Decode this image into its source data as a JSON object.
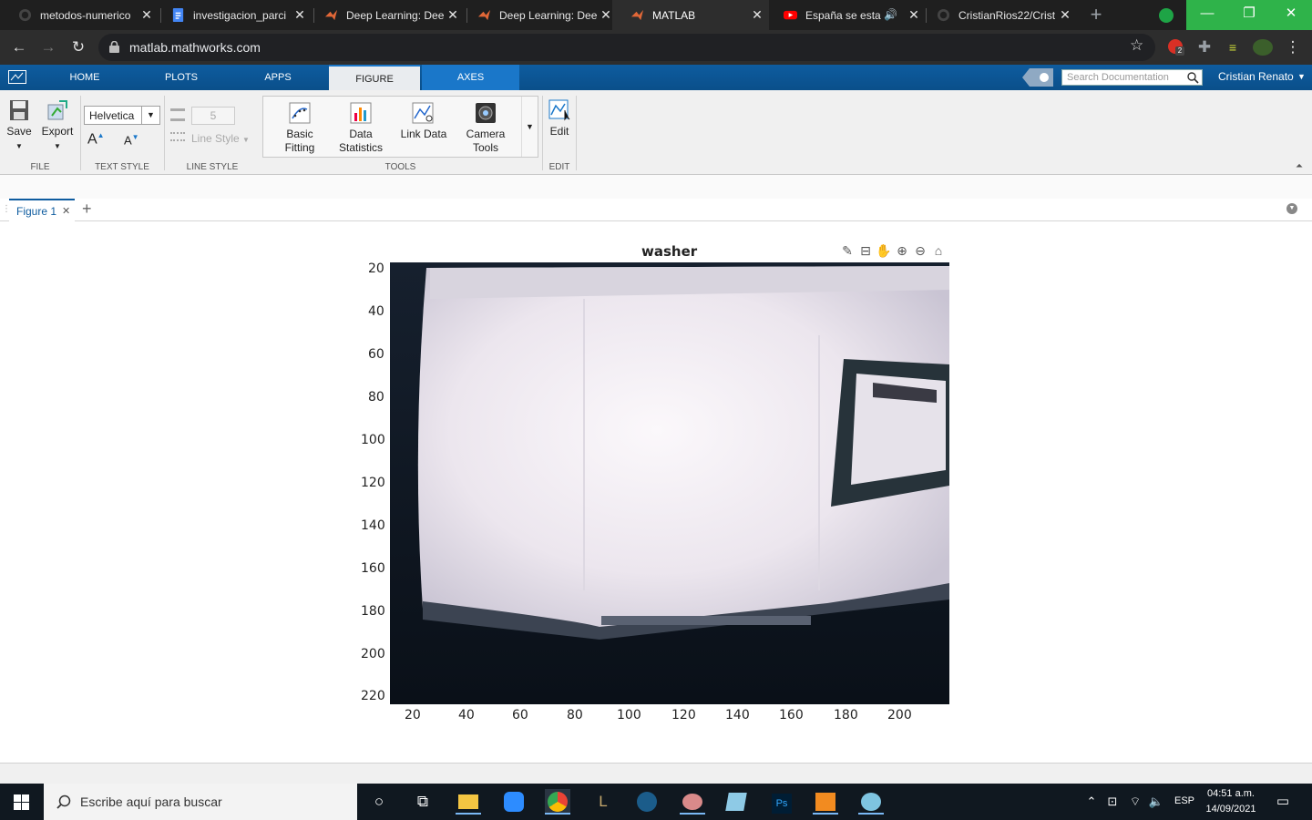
{
  "browser": {
    "tabs": [
      {
        "title": "metodos-numerico",
        "icon": "github-icon"
      },
      {
        "title": "investigacion_parci",
        "icon": "google-docs-icon"
      },
      {
        "title": "Deep Learning: Dee",
        "icon": "matlab-icon"
      },
      {
        "title": "Deep Learning: Dee",
        "icon": "matlab-icon"
      },
      {
        "title": "MATLAB",
        "icon": "matlab-icon"
      },
      {
        "title": "España se esta",
        "icon": "youtube-icon"
      },
      {
        "title": "CristianRios22/Crist",
        "icon": "github-icon"
      }
    ],
    "active_tab": 4,
    "url": "matlab.mathworks.com",
    "extension_badge": "2"
  },
  "matlab": {
    "tabs": [
      "HOME",
      "PLOTS",
      "APPS",
      "FIGURE",
      "AXES"
    ],
    "selected_tab": "FIGURE",
    "search_placeholder": "Search Documentation",
    "user_name": "Cristian Renato",
    "ribbon": {
      "file": {
        "save": "Save",
        "export": "Export",
        "label": "FILE"
      },
      "text_style": {
        "font": "Helvetica",
        "label": "TEXT STYLE"
      },
      "line_style": {
        "width": "5",
        "style": "Line Style",
        "label": "LINE STYLE"
      },
      "tools": {
        "basic_fitting": [
          "Basic",
          "Fitting"
        ],
        "data_statistics": [
          "Data",
          "Statistics"
        ],
        "link_data": "Link Data",
        "camera_tools": [
          "Camera",
          "Tools"
        ],
        "label": "TOOLS"
      },
      "edit": {
        "edit": "Edit",
        "label": "EDIT"
      }
    },
    "figure_tab": "Figure 1",
    "figure": {
      "title": "washer",
      "y_ticks": [
        "20",
        "40",
        "60",
        "80",
        "100",
        "120",
        "140",
        "160",
        "180",
        "200",
        "220"
      ],
      "x_ticks": [
        "20",
        "40",
        "60",
        "80",
        "100",
        "120",
        "140",
        "160",
        "180",
        "200"
      ]
    }
  },
  "taskbar": {
    "search_placeholder": "Escribe aquí para buscar",
    "language": "ESP",
    "time": "04:51 a.m.",
    "date": "14/09/2021"
  },
  "colors": {
    "matlab_blue": "#0e5c9f",
    "axes_blue": "#1a77c9",
    "browser_dark": "#1f1f1f"
  }
}
